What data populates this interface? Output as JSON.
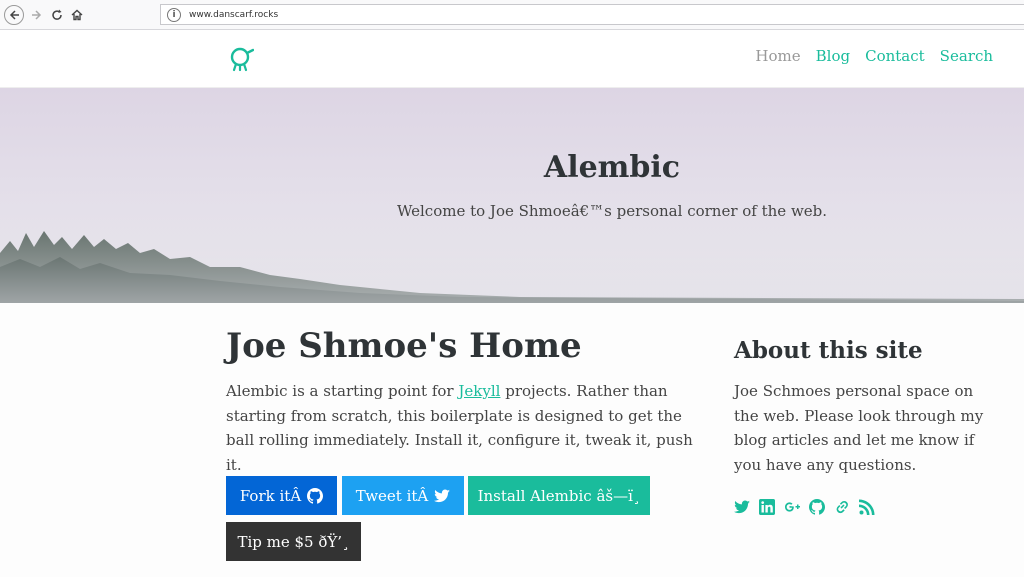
{
  "browser": {
    "url": "www.danscarf.rocks",
    "icons": [
      "back-icon",
      "forward-icon",
      "reload-icon",
      "home-icon",
      "info-icon"
    ]
  },
  "header": {
    "logo_icon": "alembic-logo-icon",
    "nav": [
      {
        "label": "Home",
        "active": true
      },
      {
        "label": "Blog",
        "active": false
      },
      {
        "label": "Contact",
        "active": false
      },
      {
        "label": "Search",
        "active": false
      }
    ]
  },
  "hero": {
    "title": "Alembic",
    "subtitle": "Welcome to Joe Shmoeâ€™s personal corner of the web."
  },
  "main": {
    "heading": "Joe Shmoe's Home",
    "intro_before": "Alembic is a starting point for ",
    "intro_link": "Jekyll",
    "intro_after": " projects. Rather than starting from scratch, this boilerplate is designed to get the ball rolling immediately. Install it, configure it, tweak it, push it.",
    "buttons": [
      {
        "label": "Fork itÂ",
        "icon": "github-icon",
        "color": "#0366d6"
      },
      {
        "label": "Tweet itÂ",
        "icon": "twitter-icon",
        "color": "#1da1f2"
      },
      {
        "label": "Install Alembic âš—ï¸",
        "icon": "",
        "color": "#1abc9c"
      },
      {
        "label": "Tip me $5 ðŸ’¸",
        "icon": "",
        "color": "#333333"
      }
    ]
  },
  "aside": {
    "heading": "About this site",
    "text": "Joe Schmoes personal space on the web. Please look through my blog articles and let me know if you have any questions.",
    "social_icons": [
      "twitter-icon",
      "linkedin-icon",
      "google-plus-icon",
      "github-icon",
      "link-icon",
      "rss-icon"
    ]
  },
  "colors": {
    "accent": "#1abc9c",
    "muted_nav": "#999999",
    "text": "#444444"
  }
}
